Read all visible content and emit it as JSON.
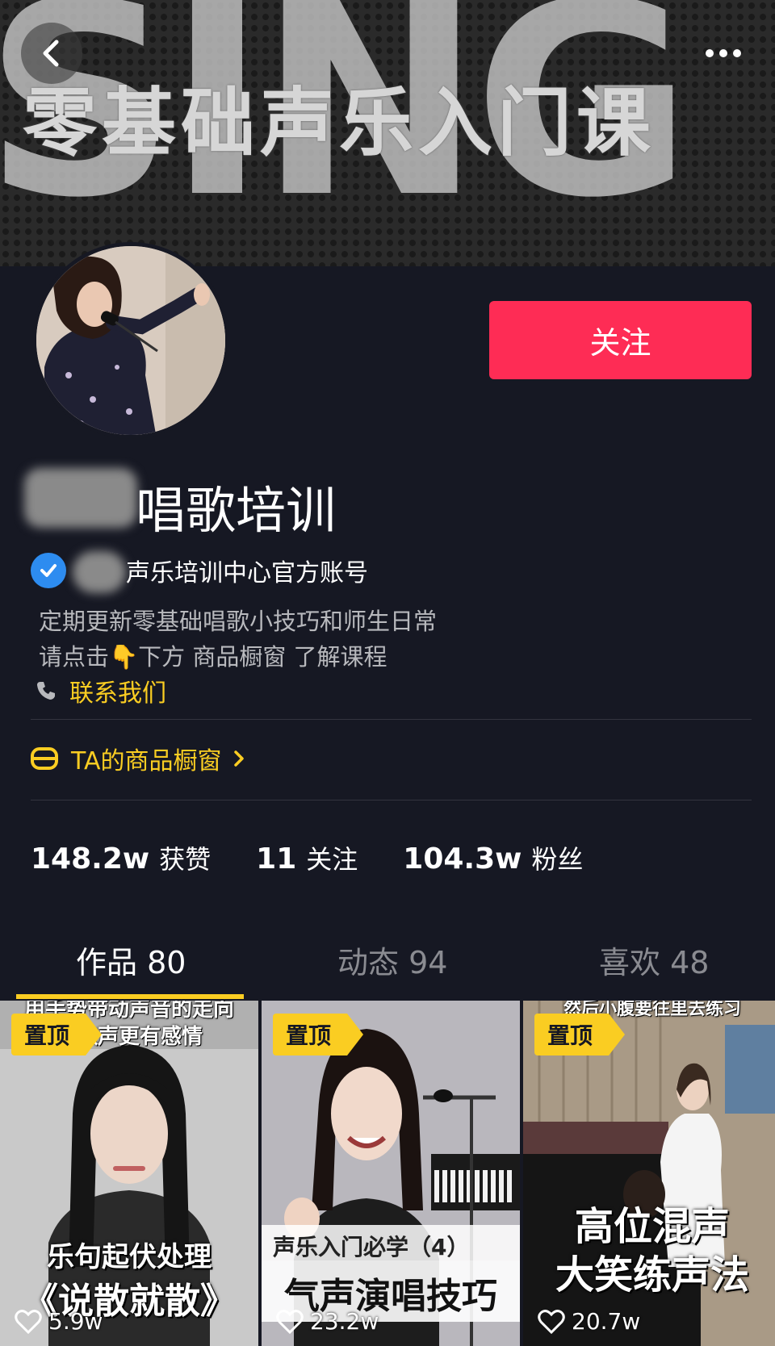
{
  "banner": {
    "background_text": "SING",
    "title": "零基础声乐入门课"
  },
  "header": {
    "back_icon": "chevron-left-icon",
    "more_icon": "more-horizontal-icon"
  },
  "profile": {
    "name": "唱歌培训",
    "verified_text": "声乐培训中心官方账号",
    "bio_line1": "定期更新零基础唱歌小技巧和师生日常",
    "bio_line2_a": "请点击",
    "bio_line2_emoji": "👇",
    "bio_line2_b": "下方 商品橱窗 了解课程",
    "contact_label": "联系我们",
    "shop_label": "TA的商品橱窗",
    "follow_label": "关注"
  },
  "stats": {
    "likes_value": "148.2w",
    "likes_label": "获赞",
    "following_value": "11",
    "following_label": "关注",
    "followers_value": "104.3w",
    "followers_label": "粉丝"
  },
  "tabs": [
    {
      "label": "作品 80",
      "active": true
    },
    {
      "label": "动态 94",
      "active": false
    },
    {
      "label": "喜欢 48",
      "active": false
    }
  ],
  "videos": [
    {
      "pin": "置顶",
      "top_caption": "用手势带动声音的走向\n让歌声更有感情",
      "caption1": "乐句起伏处理",
      "caption2": "《说散就散》",
      "likes": "5.9w"
    },
    {
      "pin": "置顶",
      "caption1": "声乐入门必学（4）",
      "caption2": "气声演唱技巧",
      "likes": "23.2w"
    },
    {
      "pin": "置顶",
      "top_caption": "然后小腹要往里去练习",
      "caption1": "高位混声",
      "caption2": "大笑练声法",
      "likes": "20.7w"
    }
  ],
  "colors": {
    "background": "#161823",
    "accent_red": "#fe2c55",
    "accent_yellow": "#facd22",
    "verify_blue": "#2d8cf0"
  }
}
